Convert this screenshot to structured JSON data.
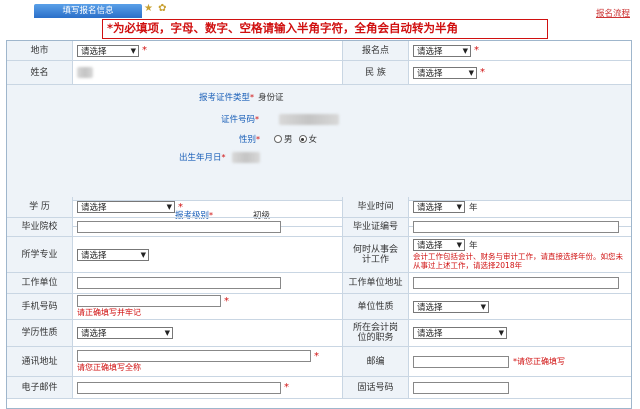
{
  "header": {
    "tab_label": "填写报名信息",
    "tab_icons": "★ ✿",
    "flow_link": "报名流程",
    "notice": "*为必填项，字母、数字、空格请输入半角字符，全角会自动转为半角"
  },
  "common": {
    "select_placeholder": "请选择",
    "required_mark": "*",
    "year_unit": "年"
  },
  "fields": {
    "region_label": "地市",
    "site_label": "报名点",
    "name_label": "姓名",
    "ethnic_label": "民 族",
    "id_type_label": "报考证件类型",
    "id_type_value": "身份证",
    "id_number_label": "证件号码",
    "gender_label": "性别",
    "gender_options": [
      "男",
      "女"
    ],
    "gender_selected": "女",
    "birth_label": "出生年月日",
    "level_label": "报考级别",
    "level_value": "初级",
    "education_label": "学 历",
    "grad_time_label": "毕业时间",
    "school_label": "毕业院校",
    "cert_no_label": "毕业证编号",
    "major_label": "所学专业",
    "work_start_label": "何时从事会计工作",
    "work_start_note": "会计工作包括会计、财务与审计工作，请直接选择年份。如您未从事过上述工作，请选择2018年",
    "employer_label": "工作单位",
    "employer_addr_label": "工作单位地址",
    "mobile_label": "手机号码",
    "mobile_error": "请正确填写并牢记",
    "unit_type_label": "单位性质",
    "edu_type_label": "学历性质",
    "position_label": "所在会计岗位的职务",
    "address_label": "通讯地址",
    "address_error": "请您正确填写全称",
    "postcode_label": "邮编",
    "postcode_error": "*请您正确填写",
    "email_label": "电子邮件",
    "phone_label": "固话号码"
  }
}
